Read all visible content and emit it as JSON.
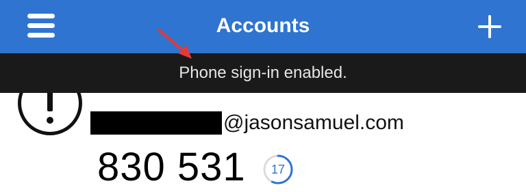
{
  "header": {
    "title": "Accounts",
    "menu_icon": "hamburger-menu-icon",
    "add_icon": "plus-icon",
    "background": "#2f74d0"
  },
  "toast": {
    "message": "Phone sign-in enabled.",
    "background": "#1a1a1a"
  },
  "annotation": {
    "arrow_color": "#e53935"
  },
  "account": {
    "status_icon": "exclamation-alert-icon",
    "email_suffix": "@jasonsamuel.com",
    "code": "830 531",
    "seconds_remaining": "17",
    "timer_fraction_remaining": 0.57,
    "timer_color": "#2f74d0"
  }
}
